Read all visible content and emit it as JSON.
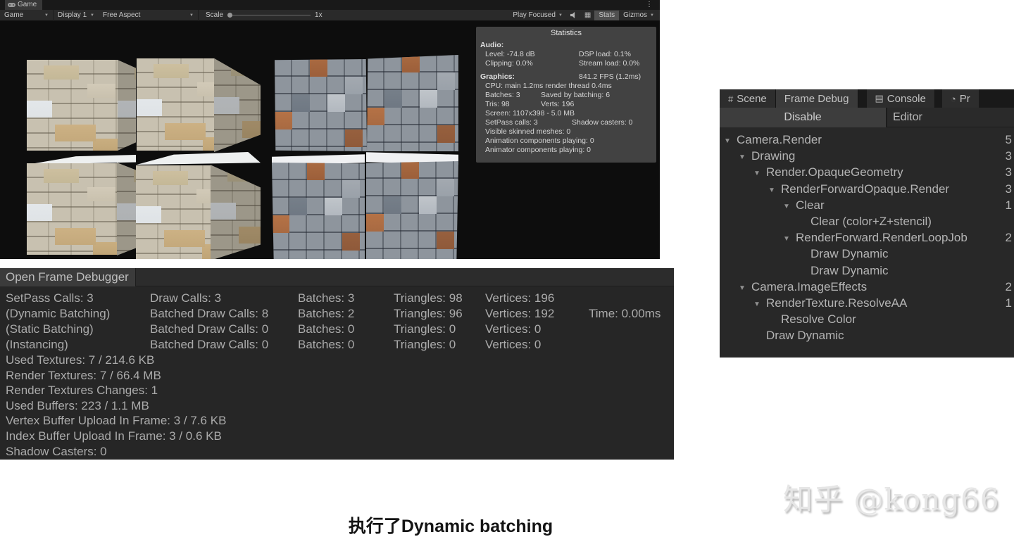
{
  "game_window": {
    "tab_label": "Game",
    "toolbar": {
      "mode": "Game",
      "display": "Display 1",
      "aspect": "Free Aspect",
      "scale_label": "Scale",
      "scale_value": "1x",
      "play_behavior": "Play Focused",
      "stats": "Stats",
      "gizmos": "Gizmos"
    },
    "viewport_objects": [
      {
        "texture": "sandstone-brick-cubes",
        "position": "top-left"
      },
      {
        "texture": "grey-rust-stone-cubes",
        "position": "top-right"
      },
      {
        "texture": "sandstone-brick-cubes",
        "position": "bottom-left"
      },
      {
        "texture": "grey-rust-stone-cubes",
        "position": "bottom-right"
      }
    ],
    "stats_overlay": {
      "title": "Statistics",
      "audio_label": "Audio:",
      "audio": {
        "level": "Level: -74.8 dB",
        "clipping": "Clipping: 0.0%",
        "dsp": "DSP load: 0.1%",
        "stream": "Stream load: 0.0%"
      },
      "graphics_label": "Graphics:",
      "fps": "841.2 FPS (1.2ms)",
      "graphics": {
        "cpu": "CPU: main 1.2ms  render thread 0.4ms",
        "batches": "Batches: 3",
        "saved": "Saved by batching: 6",
        "tris": "Tris: 98",
        "verts": "Verts: 196",
        "screen": "Screen: 1107x398 - 5.0 MB",
        "setpass": "SetPass calls: 3",
        "shadow": "Shadow casters: 0",
        "skinned": "Visible skinned meshes: 0",
        "anim": "Animation components playing: 0",
        "animator": "Animator components playing: 0"
      }
    }
  },
  "frame_debugger": {
    "open_button": "Open Frame Debugger",
    "rows": [
      {
        "c1": "SetPass Calls: 3",
        "c2": "Draw Calls: 3",
        "c3": "Batches: 3",
        "c4": "Triangles: 98",
        "c5": "Vertices: 196",
        "c6": ""
      },
      {
        "c1": "(Dynamic Batching)",
        "c2": "Batched Draw Calls: 8",
        "c3": "Batches: 2",
        "c4": "Triangles: 96",
        "c5": "Vertices: 192",
        "c6": "Time: 0.00ms"
      },
      {
        "c1": "(Static Batching)",
        "c2": "Batched Draw Calls: 0",
        "c3": "Batches: 0",
        "c4": "Triangles: 0",
        "c5": "Vertices: 0",
        "c6": ""
      },
      {
        "c1": "(Instancing)",
        "c2": "Batched Draw Calls: 0",
        "c3": "Batches: 0",
        "c4": "Triangles: 0",
        "c5": "Vertices: 0",
        "c6": ""
      }
    ],
    "lines": [
      "Used Textures: 7 / 214.6 KB",
      "Render Textures: 7 / 66.4 MB",
      "Render Textures Changes: 1",
      "Used Buffers: 223 / 1.1 MB",
      "Vertex Buffer Upload In Frame: 3 / 7.6 KB",
      "Index Buffer Upload In Frame: 3 / 0.6 KB",
      "Shadow Casters: 0"
    ]
  },
  "right_panel": {
    "tabs": {
      "scene": "Scene",
      "frame_debug": "Frame Debug",
      "console": "Console",
      "profiler": "Pr"
    },
    "disable_button": "Disable",
    "editor_label": "Editor",
    "tree": [
      {
        "level": 0,
        "arrow": true,
        "label": "Camera.Render",
        "count": "5"
      },
      {
        "level": 1,
        "arrow": true,
        "label": "Drawing",
        "count": "3"
      },
      {
        "level": 2,
        "arrow": true,
        "label": "Render.OpaqueGeometry",
        "count": "3"
      },
      {
        "level": 3,
        "arrow": true,
        "label": "RenderForwardOpaque.Render",
        "count": "3"
      },
      {
        "level": 4,
        "arrow": true,
        "label": "Clear",
        "count": "1"
      },
      {
        "level": 5,
        "arrow": false,
        "label": "Clear (color+Z+stencil)",
        "count": ""
      },
      {
        "level": 4,
        "arrow": true,
        "label": "RenderForward.RenderLoopJob",
        "count": "2"
      },
      {
        "level": 5,
        "arrow": false,
        "label": "Draw Dynamic",
        "count": ""
      },
      {
        "level": 5,
        "arrow": false,
        "label": "Draw Dynamic",
        "count": ""
      },
      {
        "level": 1,
        "arrow": true,
        "label": "Camera.ImageEffects",
        "count": "2"
      },
      {
        "level": 2,
        "arrow": true,
        "label": "RenderTexture.ResolveAA",
        "count": "1"
      },
      {
        "level": 3,
        "arrow": false,
        "label": "Resolve Color",
        "count": ""
      },
      {
        "level": 2,
        "arrow": false,
        "label": "Draw Dynamic",
        "count": ""
      }
    ]
  },
  "caption": "执行了Dynamic batching",
  "watermark": "知乎 @kong66",
  "colors": {
    "viewport_bg": "#0d0d0d",
    "panel_bg": "#262626",
    "tab_bg": "#191919",
    "button_bg": "#3b3b3b",
    "text_light": "#b4b4b4",
    "page_bg": "#ffffff"
  }
}
